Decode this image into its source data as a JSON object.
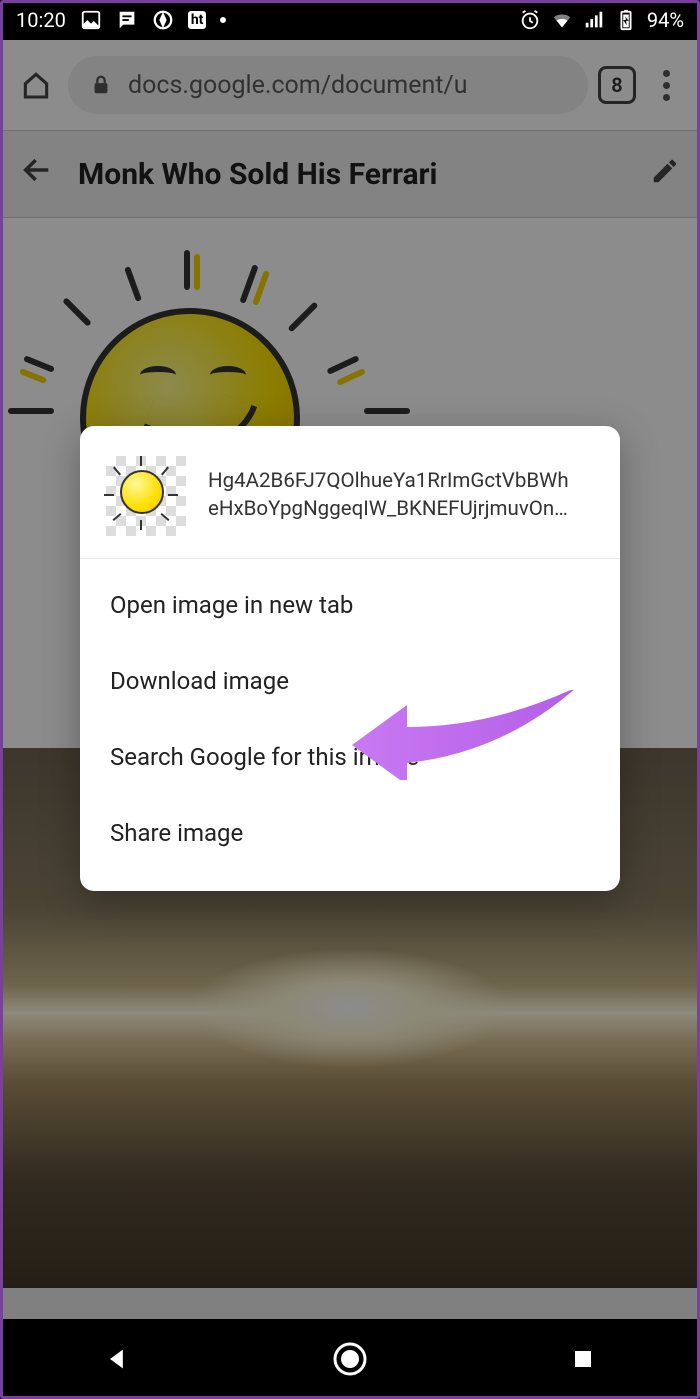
{
  "statusbar": {
    "time": "10:20",
    "ht_badge": "ht",
    "battery_text": "94%"
  },
  "browser": {
    "url_display": "docs.google.com/document/u",
    "tab_count": "8"
  },
  "doc": {
    "title": "Monk Who Sold His Ferrari"
  },
  "modal": {
    "filename_line1": "Hg4A2B6FJ7QOlhueYa1RrImGctVbBWh",
    "filename_line2": "eHxBoYpgNggeqIW_BKNEFUjrjmuvOn…",
    "items": [
      "Open image in new tab",
      "Download image",
      "Search Google for this image",
      "Share image"
    ]
  }
}
